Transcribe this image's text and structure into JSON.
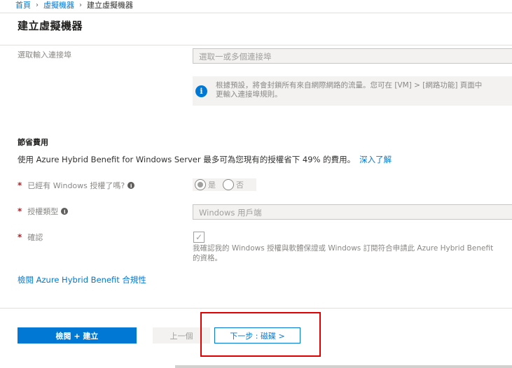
{
  "breadcrumb": {
    "items": [
      "首頁",
      "虛擬機器",
      "建立虛擬機器"
    ],
    "separator": "›"
  },
  "page": {
    "title": "建立虛擬機器"
  },
  "inbound_ports": {
    "label": "選取輸入連接埠",
    "placeholder": "選取一或多個連接埠"
  },
  "info": {
    "line1": "根據預設，將會封鎖所有來自網際網路的流量。您可在 [VM] > [網路功能] 頁面中",
    "line2": "更輸入連接埠規則。"
  },
  "savings": {
    "title": "節省費用",
    "description": "使用 Azure Hybrid Benefit for Windows Server 最多可為您現有的授權省下 49% 的費用。",
    "learn_more": "深入了解"
  },
  "has_license": {
    "label": "已經有 Windows 授權了嗎?",
    "options": [
      "是",
      "否"
    ],
    "selected": "是"
  },
  "license_type": {
    "label": "授權類型",
    "value": "Windows 用戶端"
  },
  "confirm": {
    "label": "確認",
    "checked": true,
    "line1": "我確認我的 Windows 授權與軟體保證或 Windows 訂閱符合申請此 Azure Hybrid Benefit",
    "line2": "的資格。"
  },
  "compliance_link": "檢閱 Azure Hybrid Benefit 合規性",
  "footer": {
    "review_create": "檢閱 + 建立",
    "previous": "上一個",
    "next": "下一步 : 磁碟 >"
  },
  "colors": {
    "accent": "#0078d4",
    "required": "#a4262c",
    "highlight": "#e00000"
  }
}
